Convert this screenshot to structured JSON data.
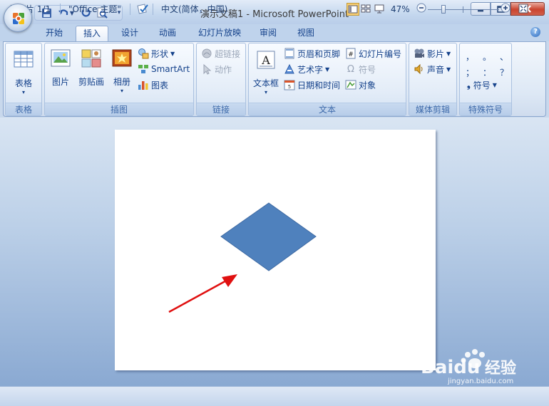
{
  "window": {
    "title": "演示文稿1 - Microsoft PowerPoint"
  },
  "tabs": [
    {
      "label": "开始"
    },
    {
      "label": "插入"
    },
    {
      "label": "设计"
    },
    {
      "label": "动画"
    },
    {
      "label": "幻灯片放映"
    },
    {
      "label": "审阅"
    },
    {
      "label": "视图"
    }
  ],
  "active_tab": "插入",
  "groups": {
    "tables": {
      "label": "表格",
      "table": "表格"
    },
    "illustrations": {
      "label": "插图",
      "picture": "图片",
      "clipart": "剪贴画",
      "album": "相册",
      "shapes": "形状",
      "smartart": "SmartArt",
      "chart": "图表"
    },
    "links": {
      "label": "链接",
      "hyperlink": "超链接",
      "action": "动作"
    },
    "text": {
      "label": "文本",
      "textbox": "文本框",
      "header_footer": "页眉和页脚",
      "wordart": "艺术字",
      "datetime": "日期和时间",
      "slide_number": "幻灯片编号",
      "symbol": "符号",
      "object": "对象"
    },
    "media": {
      "label": "媒体剪辑",
      "movie": "影片",
      "sound": "声音"
    },
    "special": {
      "label": "特殊符号",
      "symbols_row1": [
        "，",
        "。",
        "、"
      ],
      "symbols_row2": [
        "；",
        "：",
        "？"
      ],
      "symbol_button": "符号"
    }
  },
  "status": {
    "slide": "幻灯片 1/1",
    "theme": "\"Office 主题\"",
    "language": "中文(简体，中国)",
    "zoom": "47%"
  },
  "slide": {
    "shape_fill": "#4f81bd",
    "arrow_color": "#e01010"
  },
  "watermark": {
    "brand": "Baidu",
    "jingyan": "经验",
    "url": "jingyan.baidu.com"
  }
}
